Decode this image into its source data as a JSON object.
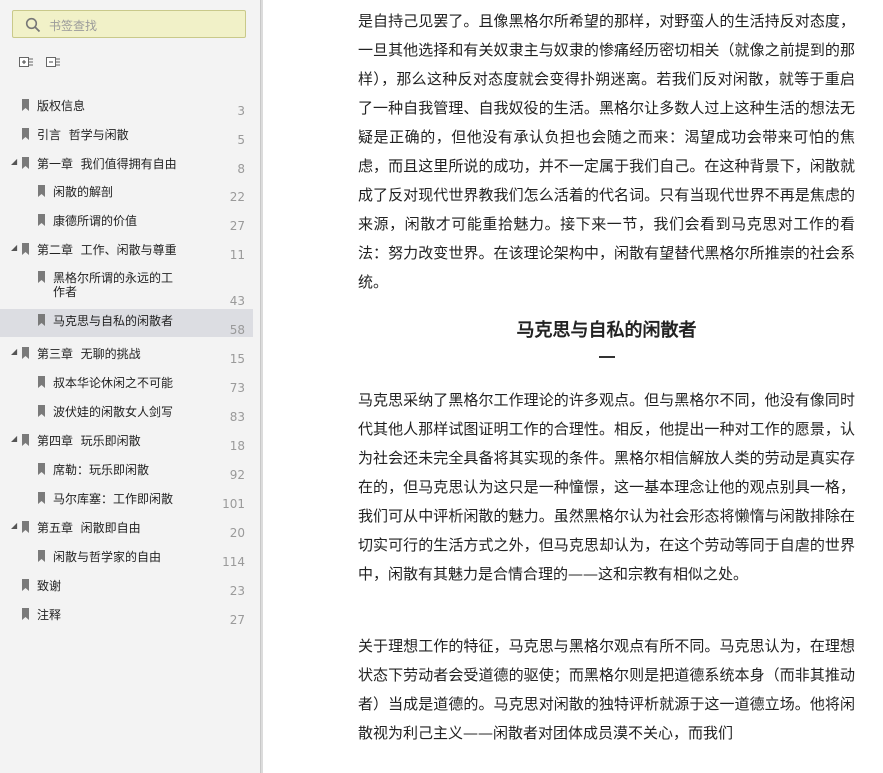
{
  "search": {
    "placeholder": "书签查找"
  },
  "toolbar": {
    "expand_label": "expand-all",
    "collapse_label": "collapse-all"
  },
  "toc": [
    {
      "label": "版权信息",
      "page": "3",
      "level": 0,
      "expanded": false
    },
    {
      "label": "引言  哲学与闲散",
      "page": "5",
      "level": 0,
      "expanded": false
    },
    {
      "label": "第一章  我们值得拥有自由",
      "page": "8",
      "level": 0,
      "expanded": true
    },
    {
      "label": "闲散的解剖",
      "page": "22",
      "level": 1
    },
    {
      "label": "康德所谓的价值",
      "page": "27",
      "level": 1
    },
    {
      "label": "第二章  工作、闲散与尊重",
      "page": "11",
      "level": 0,
      "expanded": true
    },
    {
      "label": "黑格尔所谓的永远的工作者",
      "page": "43",
      "level": 1
    },
    {
      "label": "马克思与自私的闲散者",
      "page": "58",
      "level": 1,
      "active": true
    },
    {
      "label": "第三章  无聊的挑战",
      "page": "15",
      "level": 0,
      "expanded": true
    },
    {
      "label": "叔本华论休闲之不可能",
      "page": "73",
      "level": 1
    },
    {
      "label": "波伏娃的闲散女人剑写",
      "page": "83",
      "level": 1
    },
    {
      "label": "第四章  玩乐即闲散",
      "page": "18",
      "level": 0,
      "expanded": true
    },
    {
      "label": "席勒：玩乐即闲散",
      "page": "92",
      "level": 1
    },
    {
      "label": "马尔库塞：工作即闲散",
      "page": "101",
      "level": 1
    },
    {
      "label": "第五章  闲散即自由",
      "page": "20",
      "level": 0,
      "expanded": true
    },
    {
      "label": "闲散与哲学家的自由",
      "page": "114",
      "level": 1
    },
    {
      "label": "致谢",
      "page": "23",
      "level": 0,
      "expanded": false
    },
    {
      "label": "注释",
      "page": "27",
      "level": 0,
      "expanded": false
    }
  ],
  "reader": {
    "para1": "是自持己见罢了。且像黑格尔所希望的那样，对野蛮人的生活持反对态度，一旦其他选择和有关奴隶主与奴隶的惨痛经历密切相关（就像之前提到的那样），那么这种反对态度就会变得扑朔迷离。若我们反对闲散，就等于重启了一种自我管理、自我奴役的生活。黑格尔让多数人过上这种生活的想法无疑是正确的，但他没有承认负担也会随之而来：渴望成功会带来可怕的焦虑，而且这里所说的成功，并不一定属于我们自己。在这种背景下，闲散就成了反对现代世界教我们怎么活着的代名词。只有当现代世界不再是焦虑的来源，闲散才可能重拾魅力。接下来一节，我们会看到马克思对工作的看法：努力改变世界。在该理论架构中，闲散有望替代黑格尔所推崇的社会系统。",
    "heading": "马克思与自私的闲散者",
    "heading_dash": "—",
    "para2": "马克思采纳了黑格尔工作理论的许多观点。但与黑格尔不同，他没有像同时代其他人那样试图证明工作的合理性。相反，他提出一种对工作的愿景，认为社会还未完全具备将其实现的条件。黑格尔相信解放人类的劳动是真实存在的，但马克思认为这只是一种憧憬，这一基本理念让他的观点别具一格，我们可从中评析闲散的魅力。虽然黑格尔认为社会形态将懒惰与闲散排除在切实可行的生活方式之外，但马克思却认为，在这个劳动等同于自虐的世界中，闲散有其魅力是合情合理的——这和宗教有相似之处。",
    "para3": "关于理想工作的特征，马克思与黑格尔观点有所不同。马克思认为，在理想状态下劳动者会受道德的驱使；而黑格尔则是把道德系统本身（而非其推动者）当成是道德的。马克思对闲散的独特评析就源于这一道德立场。他将闲散视为利己主义——闲散者对团体成员漠不关心，而我们"
  }
}
